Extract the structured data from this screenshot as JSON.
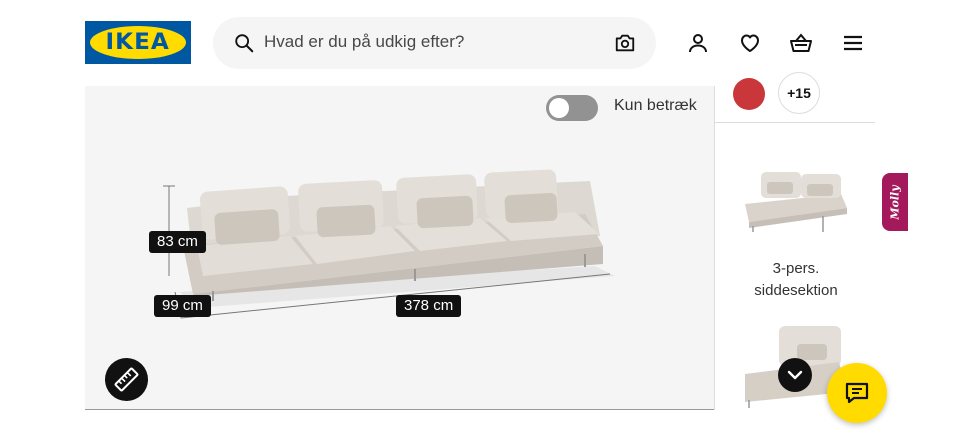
{
  "header": {
    "logo_text": "IKEA",
    "search": {
      "placeholder": "Hvad er du på udkig efter?"
    },
    "icons": [
      "search-icon",
      "camera-icon",
      "user-icon",
      "heart-icon",
      "basket-icon",
      "menu-icon"
    ]
  },
  "viewer": {
    "toggle_label": "Kun betræk",
    "toggle_on": false,
    "dimensions": {
      "height": "83 cm",
      "depth": "99 cm",
      "width": "378 cm"
    }
  },
  "sidebar": {
    "swatch_color": "#c9373a",
    "more_colors": "+15",
    "product_label": "3-pers. siddesektion"
  },
  "floating": {
    "molly_label": "Molly",
    "chat_color": "#ffdb00"
  }
}
